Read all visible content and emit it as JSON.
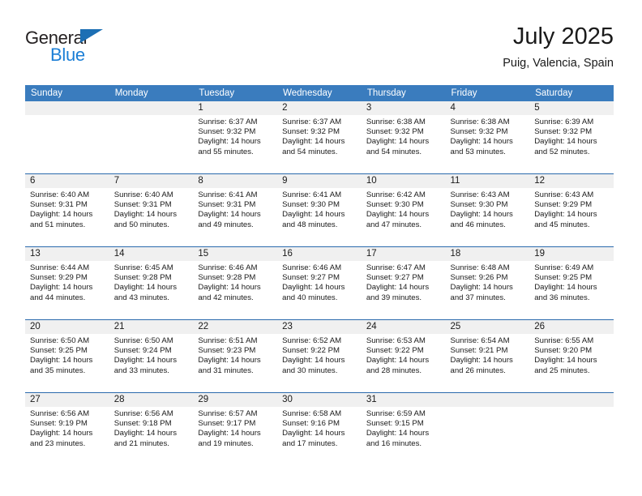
{
  "brand": {
    "name_top": "General",
    "name_bottom": "Blue",
    "triangle_color": "#1c6fb4",
    "blue_color": "#1c7fd6"
  },
  "header": {
    "title": "July 2025",
    "location": "Puig, Valencia, Spain"
  },
  "colors": {
    "header_row_bg": "#3a7cbe",
    "week_divider": "#2a6aad",
    "daynum_band_bg": "#f0f0f0",
    "text": "#1a1a1a"
  },
  "calendar": {
    "weekday_headers": [
      "Sunday",
      "Monday",
      "Tuesday",
      "Wednesday",
      "Thursday",
      "Friday",
      "Saturday"
    ],
    "weeks": [
      [
        {
          "day": "",
          "lines": []
        },
        {
          "day": "",
          "lines": []
        },
        {
          "day": "1",
          "lines": [
            "Sunrise: 6:37 AM",
            "Sunset: 9:32 PM",
            "Daylight: 14 hours",
            "and 55 minutes."
          ]
        },
        {
          "day": "2",
          "lines": [
            "Sunrise: 6:37 AM",
            "Sunset: 9:32 PM",
            "Daylight: 14 hours",
            "and 54 minutes."
          ]
        },
        {
          "day": "3",
          "lines": [
            "Sunrise: 6:38 AM",
            "Sunset: 9:32 PM",
            "Daylight: 14 hours",
            "and 54 minutes."
          ]
        },
        {
          "day": "4",
          "lines": [
            "Sunrise: 6:38 AM",
            "Sunset: 9:32 PM",
            "Daylight: 14 hours",
            "and 53 minutes."
          ]
        },
        {
          "day": "5",
          "lines": [
            "Sunrise: 6:39 AM",
            "Sunset: 9:32 PM",
            "Daylight: 14 hours",
            "and 52 minutes."
          ]
        }
      ],
      [
        {
          "day": "6",
          "lines": [
            "Sunrise: 6:40 AM",
            "Sunset: 9:31 PM",
            "Daylight: 14 hours",
            "and 51 minutes."
          ]
        },
        {
          "day": "7",
          "lines": [
            "Sunrise: 6:40 AM",
            "Sunset: 9:31 PM",
            "Daylight: 14 hours",
            "and 50 minutes."
          ]
        },
        {
          "day": "8",
          "lines": [
            "Sunrise: 6:41 AM",
            "Sunset: 9:31 PM",
            "Daylight: 14 hours",
            "and 49 minutes."
          ]
        },
        {
          "day": "9",
          "lines": [
            "Sunrise: 6:41 AM",
            "Sunset: 9:30 PM",
            "Daylight: 14 hours",
            "and 48 minutes."
          ]
        },
        {
          "day": "10",
          "lines": [
            "Sunrise: 6:42 AM",
            "Sunset: 9:30 PM",
            "Daylight: 14 hours",
            "and 47 minutes."
          ]
        },
        {
          "day": "11",
          "lines": [
            "Sunrise: 6:43 AM",
            "Sunset: 9:30 PM",
            "Daylight: 14 hours",
            "and 46 minutes."
          ]
        },
        {
          "day": "12",
          "lines": [
            "Sunrise: 6:43 AM",
            "Sunset: 9:29 PM",
            "Daylight: 14 hours",
            "and 45 minutes."
          ]
        }
      ],
      [
        {
          "day": "13",
          "lines": [
            "Sunrise: 6:44 AM",
            "Sunset: 9:29 PM",
            "Daylight: 14 hours",
            "and 44 minutes."
          ]
        },
        {
          "day": "14",
          "lines": [
            "Sunrise: 6:45 AM",
            "Sunset: 9:28 PM",
            "Daylight: 14 hours",
            "and 43 minutes."
          ]
        },
        {
          "day": "15",
          "lines": [
            "Sunrise: 6:46 AM",
            "Sunset: 9:28 PM",
            "Daylight: 14 hours",
            "and 42 minutes."
          ]
        },
        {
          "day": "16",
          "lines": [
            "Sunrise: 6:46 AM",
            "Sunset: 9:27 PM",
            "Daylight: 14 hours",
            "and 40 minutes."
          ]
        },
        {
          "day": "17",
          "lines": [
            "Sunrise: 6:47 AM",
            "Sunset: 9:27 PM",
            "Daylight: 14 hours",
            "and 39 minutes."
          ]
        },
        {
          "day": "18",
          "lines": [
            "Sunrise: 6:48 AM",
            "Sunset: 9:26 PM",
            "Daylight: 14 hours",
            "and 37 minutes."
          ]
        },
        {
          "day": "19",
          "lines": [
            "Sunrise: 6:49 AM",
            "Sunset: 9:25 PM",
            "Daylight: 14 hours",
            "and 36 minutes."
          ]
        }
      ],
      [
        {
          "day": "20",
          "lines": [
            "Sunrise: 6:50 AM",
            "Sunset: 9:25 PM",
            "Daylight: 14 hours",
            "and 35 minutes."
          ]
        },
        {
          "day": "21",
          "lines": [
            "Sunrise: 6:50 AM",
            "Sunset: 9:24 PM",
            "Daylight: 14 hours",
            "and 33 minutes."
          ]
        },
        {
          "day": "22",
          "lines": [
            "Sunrise: 6:51 AM",
            "Sunset: 9:23 PM",
            "Daylight: 14 hours",
            "and 31 minutes."
          ]
        },
        {
          "day": "23",
          "lines": [
            "Sunrise: 6:52 AM",
            "Sunset: 9:22 PM",
            "Daylight: 14 hours",
            "and 30 minutes."
          ]
        },
        {
          "day": "24",
          "lines": [
            "Sunrise: 6:53 AM",
            "Sunset: 9:22 PM",
            "Daylight: 14 hours",
            "and 28 minutes."
          ]
        },
        {
          "day": "25",
          "lines": [
            "Sunrise: 6:54 AM",
            "Sunset: 9:21 PM",
            "Daylight: 14 hours",
            "and 26 minutes."
          ]
        },
        {
          "day": "26",
          "lines": [
            "Sunrise: 6:55 AM",
            "Sunset: 9:20 PM",
            "Daylight: 14 hours",
            "and 25 minutes."
          ]
        }
      ],
      [
        {
          "day": "27",
          "lines": [
            "Sunrise: 6:56 AM",
            "Sunset: 9:19 PM",
            "Daylight: 14 hours",
            "and 23 minutes."
          ]
        },
        {
          "day": "28",
          "lines": [
            "Sunrise: 6:56 AM",
            "Sunset: 9:18 PM",
            "Daylight: 14 hours",
            "and 21 minutes."
          ]
        },
        {
          "day": "29",
          "lines": [
            "Sunrise: 6:57 AM",
            "Sunset: 9:17 PM",
            "Daylight: 14 hours",
            "and 19 minutes."
          ]
        },
        {
          "day": "30",
          "lines": [
            "Sunrise: 6:58 AM",
            "Sunset: 9:16 PM",
            "Daylight: 14 hours",
            "and 17 minutes."
          ]
        },
        {
          "day": "31",
          "lines": [
            "Sunrise: 6:59 AM",
            "Sunset: 9:15 PM",
            "Daylight: 14 hours",
            "and 16 minutes."
          ]
        },
        {
          "day": "",
          "lines": []
        },
        {
          "day": "",
          "lines": []
        }
      ]
    ]
  }
}
